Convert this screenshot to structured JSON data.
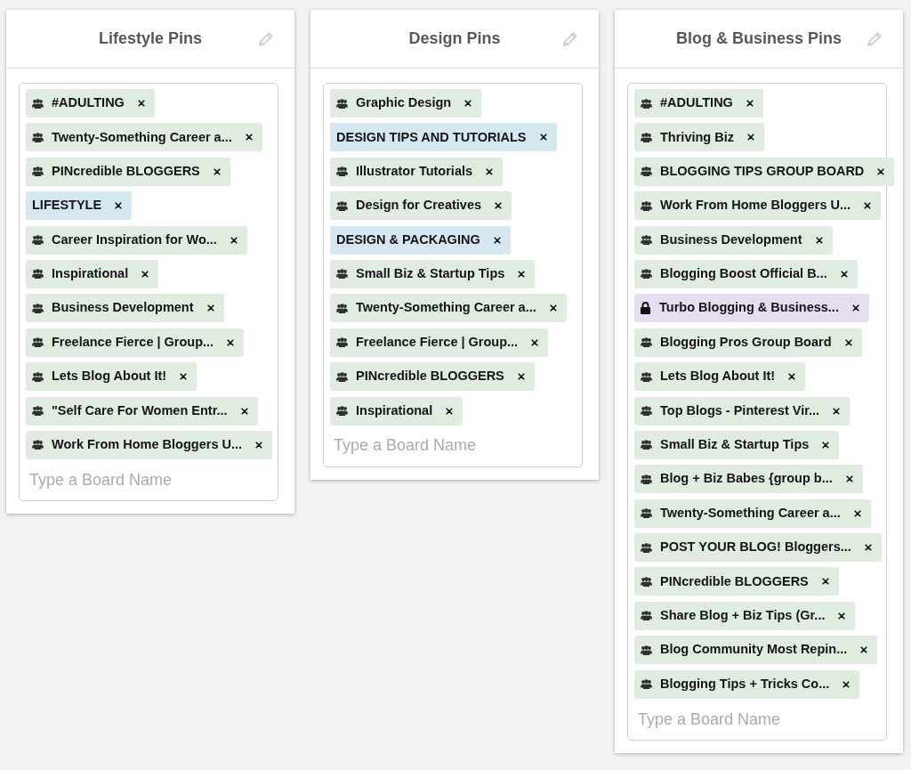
{
  "boards": [
    {
      "title": "Lifestyle Pins",
      "tags": [
        {
          "kind": "group",
          "label": "#ADULTING"
        },
        {
          "kind": "group",
          "label": "Twenty-Something Career a..."
        },
        {
          "kind": "group",
          "label": "PINcredible BLOGGERS"
        },
        {
          "kind": "board",
          "label": "LIFESTYLE"
        },
        {
          "kind": "group",
          "label": "Career Inspiration for Wo..."
        },
        {
          "kind": "group",
          "label": "Inspirational"
        },
        {
          "kind": "group",
          "label": "Business Development"
        },
        {
          "kind": "group",
          "label": "Freelance Fierce | Group..."
        },
        {
          "kind": "group",
          "label": "Lets Blog About It!"
        },
        {
          "kind": "group",
          "label": "\"Self Care For Women Entr..."
        },
        {
          "kind": "group",
          "label": "Work From Home Bloggers U..."
        }
      ],
      "input": {
        "placeholder": "Type a Board Name"
      }
    },
    {
      "title": "Design Pins",
      "tags": [
        {
          "kind": "group",
          "label": "Graphic Design"
        },
        {
          "kind": "board",
          "label": "DESIGN TIPS AND TUTORIALS"
        },
        {
          "kind": "group",
          "label": "Illustrator Tutorials"
        },
        {
          "kind": "group",
          "label": "Design for Creatives"
        },
        {
          "kind": "board",
          "label": "DESIGN & PACKAGING"
        },
        {
          "kind": "group",
          "label": "Small Biz & Startup Tips"
        },
        {
          "kind": "group",
          "label": "Twenty-Something Career a..."
        },
        {
          "kind": "group",
          "label": "Freelance Fierce | Group..."
        },
        {
          "kind": "group",
          "label": "PINcredible BLOGGERS"
        },
        {
          "kind": "group",
          "label": "Inspirational"
        }
      ],
      "input": {
        "placeholder": "Type a Board Name"
      }
    },
    {
      "title": "Blog & Business Pins",
      "tags": [
        {
          "kind": "group",
          "label": "#ADULTING"
        },
        {
          "kind": "group",
          "label": "Thriving Biz"
        },
        {
          "kind": "group",
          "label": "BLOGGING TIPS GROUP BOARD"
        },
        {
          "kind": "group",
          "label": "Work From Home Bloggers U..."
        },
        {
          "kind": "group",
          "label": "Business Development"
        },
        {
          "kind": "group",
          "label": "Blogging Boost Official B..."
        },
        {
          "kind": "secret",
          "label": "Turbo Blogging & Business..."
        },
        {
          "kind": "group",
          "label": "Blogging Pros Group Board"
        },
        {
          "kind": "group",
          "label": "Lets Blog About It!"
        },
        {
          "kind": "group",
          "label": "Top Blogs - Pinterest Vir..."
        },
        {
          "kind": "group",
          "label": "Small Biz & Startup Tips"
        },
        {
          "kind": "group",
          "label": "Blog + Biz Babes {group b..."
        },
        {
          "kind": "group",
          "label": "Twenty-Something Career a..."
        },
        {
          "kind": "group",
          "label": "POST YOUR BLOG! Bloggers..."
        },
        {
          "kind": "group",
          "label": "PINcredible BLOGGERS"
        },
        {
          "kind": "group",
          "label": "Share Blog + Biz Tips (Gr..."
        },
        {
          "kind": "group",
          "label": "Blog Community Most Repin..."
        },
        {
          "kind": "group",
          "label": "Blogging Tips + Tricks Co..."
        }
      ],
      "input": {
        "placeholder": "Type a Board Name"
      }
    }
  ]
}
